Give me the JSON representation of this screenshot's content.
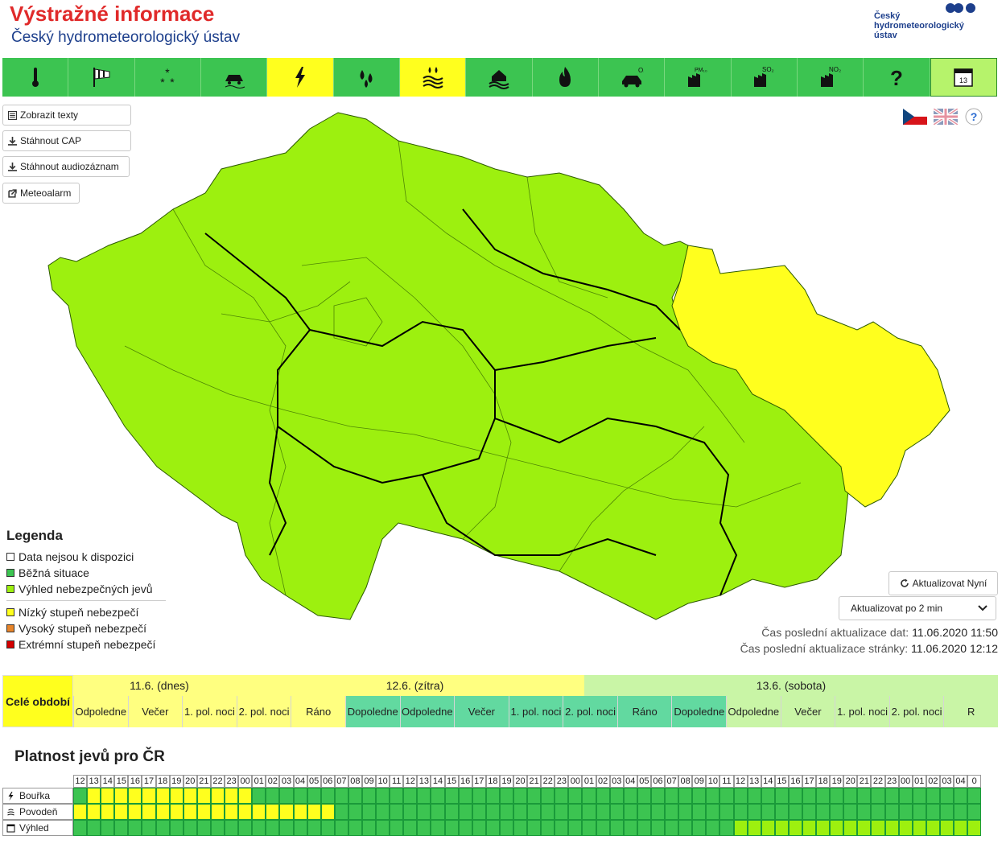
{
  "header": {
    "title": "Výstražné informace",
    "subtitle": "Český hydrometeorologický ústav",
    "logo_text": [
      "Český",
      "hydrometeorologický",
      "ústav"
    ]
  },
  "toolbar": {
    "items": [
      {
        "icon": "thermometer-icon",
        "state": "green"
      },
      {
        "icon": "wind-icon",
        "state": "green"
      },
      {
        "icon": "snow-icon",
        "state": "green"
      },
      {
        "icon": "road-ice-icon",
        "state": "green"
      },
      {
        "icon": "storm-icon",
        "state": "yellow"
      },
      {
        "icon": "rain-icon",
        "state": "green"
      },
      {
        "icon": "flood-icon",
        "state": "yellow"
      },
      {
        "icon": "flood-house-icon",
        "state": "green"
      },
      {
        "icon": "fire-icon",
        "state": "green"
      },
      {
        "icon": "ozone-icon",
        "label": "O₃",
        "state": "green"
      },
      {
        "icon": "pm10-icon",
        "label": "PM₁₀",
        "state": "green"
      },
      {
        "icon": "so2-icon",
        "label": "SO₂",
        "state": "green"
      },
      {
        "icon": "no2-icon",
        "label": "NO₂",
        "state": "green"
      },
      {
        "icon": "help-icon",
        "label": "?",
        "state": "green"
      },
      {
        "icon": "calendar-icon",
        "label": "13",
        "state": "lightgreen"
      }
    ]
  },
  "buttons": {
    "show_texts": "Zobrazit texty",
    "download_cap": "Stáhnout CAP",
    "download_audio": "Stáhnout audiozáznam",
    "meteoalarm": "Meteoalarm"
  },
  "legend": {
    "title": "Legenda",
    "items": [
      {
        "label": "Data nejsou k dispozici",
        "color": "#ffffff"
      },
      {
        "label": "Běžná situace",
        "color": "#3cc451"
      },
      {
        "label": "Výhled nebezpečných jevů",
        "color": "#9df00f"
      },
      {
        "label": "Nízký stupeň nebezpečí",
        "color": "#ffff1e"
      },
      {
        "label": "Vysoký stupeň nebezpečí",
        "color": "#e8852a"
      },
      {
        "label": "Extrémní stupeň nebezpečí",
        "color": "#d40000"
      }
    ]
  },
  "update": {
    "refresh_now": "Aktualizovat Nyní",
    "interval": "Aktualizovat po 2 min",
    "data_label": "Čas poslední aktualizace dat:",
    "data_time": "11.06.2020 11:50",
    "page_label": "Čas poslední aktualizace stránky:",
    "page_time": "11.06.2020 12:12"
  },
  "period": {
    "all_label": "Celé období",
    "days": [
      {
        "label": "11.6. (dnes)",
        "color": "#ffff80"
      },
      {
        "label": "12.6. (zítra)",
        "color": "#ffff80"
      },
      {
        "label": "13.6. (sobota)",
        "color": "#c9f5a6"
      }
    ],
    "slots": [
      {
        "label": "Odpoledne",
        "color": "#ffff80"
      },
      {
        "label": "Večer",
        "color": "#ffff80"
      },
      {
        "label": "1. pol. noci",
        "color": "#ffff80"
      },
      {
        "label": "2. pol. noci",
        "color": "#ffff80"
      },
      {
        "label": "Ráno",
        "color": "#ffff80"
      },
      {
        "label": "Dopoledne",
        "color": "#62d9a0"
      },
      {
        "label": "Odpoledne",
        "color": "#62d9a0"
      },
      {
        "label": "Večer",
        "color": "#62d9a0"
      },
      {
        "label": "1. pol. noci",
        "color": "#62d9a0"
      },
      {
        "label": "2. pol. noci",
        "color": "#62d9a0"
      },
      {
        "label": "Ráno",
        "color": "#62d9a0"
      },
      {
        "label": "Dopoledne",
        "color": "#62d9a0"
      },
      {
        "label": "Odpoledne",
        "color": "#c9f5a6"
      },
      {
        "label": "Večer",
        "color": "#c9f5a6"
      },
      {
        "label": "1. pol. noci",
        "color": "#c9f5a6"
      },
      {
        "label": "2. pol. noci",
        "color": "#c9f5a6"
      },
      {
        "label": "R",
        "color": "#c9f5a6"
      }
    ]
  },
  "validity": {
    "title": "Platnost jevů pro ČR",
    "hours": [
      "12",
      "13",
      "14",
      "15",
      "16",
      "17",
      "18",
      "19",
      "20",
      "21",
      "22",
      "23",
      "00",
      "01",
      "02",
      "03",
      "04",
      "05",
      "06",
      "07",
      "08",
      "09",
      "10",
      "11",
      "12",
      "13",
      "14",
      "15",
      "16",
      "17",
      "18",
      "19",
      "20",
      "21",
      "22",
      "23",
      "00",
      "01",
      "02",
      "03",
      "04",
      "05",
      "06",
      "07",
      "08",
      "09",
      "10",
      "11",
      "12",
      "13",
      "14",
      "15",
      "16",
      "17",
      "18",
      "19",
      "20",
      "21",
      "22",
      "23",
      "00",
      "01",
      "02",
      "03",
      "04",
      "0"
    ],
    "rows": [
      {
        "label": "Bouřka",
        "icon": "storm-icon",
        "yellow_from": 1,
        "yellow_to": 12,
        "lime_from": -1,
        "lime_to": -1
      },
      {
        "label": "Povodeň",
        "icon": "flood-icon",
        "yellow_from": 0,
        "yellow_to": 18,
        "lime_from": -1,
        "lime_to": -1
      },
      {
        "label": "Výhled",
        "icon": "outlook-icon",
        "yellow_from": -1,
        "yellow_to": -1,
        "lime_from": 48,
        "lime_to": 66
      }
    ],
    "colors": {
      "green": "#3cc451",
      "yellow": "#ffff1e",
      "lime": "#9df00f"
    }
  }
}
